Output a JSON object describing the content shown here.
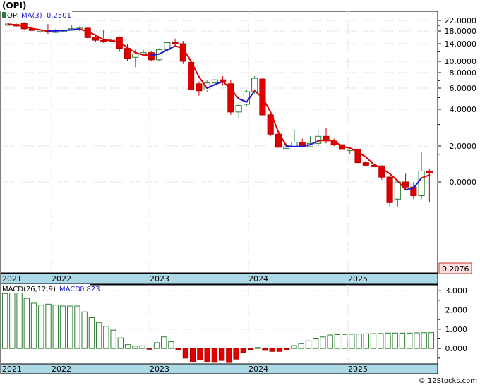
{
  "title": "(OPI)",
  "footer": "© 12Stocks.com",
  "chart_data": [
    {
      "type": "candlestick",
      "legend": {
        "symbol": "OPI",
        "ma_label": "MA(3)",
        "ma_value": "0.2501"
      },
      "last_price_label": "0.2076",
      "y_tick_labels": [
        "22.0000",
        "18.0000",
        "14.0000",
        "10.0000",
        "8.0000",
        "6.0000",
        "4.0000",
        "2.0000",
        "0.0000"
      ],
      "y_tick_values": [
        22,
        18,
        14,
        10,
        8,
        6,
        4,
        2,
        0.1
      ],
      "scale": "log",
      "x_tick_labels": [
        "2021",
        "2022",
        "2023",
        "2024",
        "2025"
      ],
      "x_tick_index": [
        0,
        10,
        20,
        30,
        40
      ],
      "bars": [
        {
          "o": 20.5,
          "h": 21.0,
          "l": 19.8,
          "c": 20.6,
          "up": true
        },
        {
          "o": 20.4,
          "h": 20.9,
          "l": 19.5,
          "c": 19.8,
          "up": false
        },
        {
          "o": 20.8,
          "h": 21.3,
          "l": 18.5,
          "c": 18.8,
          "up": false
        },
        {
          "o": 18.8,
          "h": 19.5,
          "l": 17.5,
          "c": 18.2,
          "up": false
        },
        {
          "o": 17.8,
          "h": 18.6,
          "l": 17.0,
          "c": 18.3,
          "up": true
        },
        {
          "o": 18.2,
          "h": 20.5,
          "l": 17.0,
          "c": 17.8,
          "up": false
        },
        {
          "o": 17.9,
          "h": 18.9,
          "l": 17.2,
          "c": 18.0,
          "up": true
        },
        {
          "o": 18.0,
          "h": 20.2,
          "l": 17.5,
          "c": 18.3,
          "up": true
        },
        {
          "o": 18.6,
          "h": 20.0,
          "l": 18.1,
          "c": 18.8,
          "up": true
        },
        {
          "o": 19.0,
          "h": 19.8,
          "l": 18.0,
          "c": 18.9,
          "up": true
        },
        {
          "o": 19.0,
          "h": 19.3,
          "l": 15.5,
          "c": 15.8,
          "up": false
        },
        {
          "o": 16.0,
          "h": 16.8,
          "l": 14.5,
          "c": 15.0,
          "up": false
        },
        {
          "o": 14.9,
          "h": 18.5,
          "l": 14.2,
          "c": 14.5,
          "up": false
        },
        {
          "o": 14.6,
          "h": 15.5,
          "l": 14.3,
          "c": 15.3,
          "up": true
        },
        {
          "o": 15.9,
          "h": 16.2,
          "l": 12.0,
          "c": 12.8,
          "up": false
        },
        {
          "o": 12.8,
          "h": 13.8,
          "l": 10.0,
          "c": 10.5,
          "up": false
        },
        {
          "o": 10.8,
          "h": 12.5,
          "l": 8.9,
          "c": 11.5,
          "up": true
        },
        {
          "o": 11.5,
          "h": 12.5,
          "l": 11.2,
          "c": 11.8,
          "up": true
        },
        {
          "o": 11.8,
          "h": 12.2,
          "l": 10.0,
          "c": 10.3,
          "up": false
        },
        {
          "o": 10.3,
          "h": 12.8,
          "l": 10.1,
          "c": 12.5,
          "up": true
        },
        {
          "o": 12.5,
          "h": 14.5,
          "l": 11.8,
          "c": 14.3,
          "up": true
        },
        {
          "o": 14.3,
          "h": 15.5,
          "l": 13.5,
          "c": 14.1,
          "up": false
        },
        {
          "o": 14.0,
          "h": 14.8,
          "l": 9.5,
          "c": 10.0,
          "up": false
        },
        {
          "o": 9.8,
          "h": 10.0,
          "l": 5.5,
          "c": 5.8,
          "up": false
        },
        {
          "o": 6.5,
          "h": 6.8,
          "l": 5.2,
          "c": 5.7,
          "up": false
        },
        {
          "o": 5.8,
          "h": 7.0,
          "l": 5.6,
          "c": 6.6,
          "up": true
        },
        {
          "o": 6.6,
          "h": 7.5,
          "l": 6.2,
          "c": 7.0,
          "up": true
        },
        {
          "o": 7.0,
          "h": 7.5,
          "l": 6.3,
          "c": 6.8,
          "up": false
        },
        {
          "o": 6.5,
          "h": 7.0,
          "l": 3.6,
          "c": 3.8,
          "up": false
        },
        {
          "o": 3.8,
          "h": 4.5,
          "l": 3.4,
          "c": 4.3,
          "up": true
        },
        {
          "o": 4.4,
          "h": 5.8,
          "l": 4.2,
          "c": 5.6,
          "up": true
        },
        {
          "o": 5.6,
          "h": 7.5,
          "l": 5.4,
          "c": 7.2,
          "up": true
        },
        {
          "o": 7.1,
          "h": 7.2,
          "l": 3.5,
          "c": 3.6,
          "up": false
        },
        {
          "o": 3.6,
          "h": 3.7,
          "l": 2.4,
          "c": 2.5,
          "up": false
        },
        {
          "o": 2.5,
          "h": 2.6,
          "l": 1.75,
          "c": 1.8,
          "up": false
        },
        {
          "o": 1.8,
          "h": 2.1,
          "l": 1.7,
          "c": 1.85,
          "up": true
        },
        {
          "o": 1.9,
          "h": 2.7,
          "l": 1.85,
          "c": 2.15,
          "up": true
        },
        {
          "o": 2.15,
          "h": 2.3,
          "l": 1.8,
          "c": 1.9,
          "up": false
        },
        {
          "o": 1.9,
          "h": 2.4,
          "l": 1.8,
          "c": 2.1,
          "up": true
        },
        {
          "o": 2.1,
          "h": 2.7,
          "l": 2.0,
          "c": 2.4,
          "up": true
        },
        {
          "o": 2.4,
          "h": 2.8,
          "l": 2.1,
          "c": 2.2,
          "up": false
        },
        {
          "o": 2.2,
          "h": 2.3,
          "l": 2.0,
          "c": 2.05,
          "up": false
        },
        {
          "o": 2.05,
          "h": 2.1,
          "l": 1.4,
          "c": 1.5,
          "up": false
        },
        {
          "o": 1.45,
          "h": 1.65,
          "l": 1.0,
          "c": 1.55,
          "up": true
        },
        {
          "o": 1.5,
          "h": 1.55,
          "l": 0.48,
          "c": 0.5,
          "up": false
        },
        {
          "o": 0.5,
          "h": 0.55,
          "l": 0.34,
          "c": 0.4,
          "up": false
        },
        {
          "o": 0.4,
          "h": 0.41,
          "l": 0.38,
          "c": 0.39,
          "up": false
        },
        {
          "o": 0.38,
          "h": 0.4,
          "l": 0.12,
          "c": 0.15,
          "up": false
        },
        {
          "o": 0.15,
          "h": 0.16,
          "l": 0.06,
          "c": 0.065,
          "up": false
        },
        {
          "o": 0.07,
          "h": 0.12,
          "l": 0.06,
          "c": 0.1,
          "up": true
        },
        {
          "o": 0.1,
          "h": 0.2,
          "l": 0.085,
          "c": 0.09,
          "up": false
        },
        {
          "o": 0.09,
          "h": 0.1,
          "l": 0.07,
          "c": 0.075,
          "up": false
        },
        {
          "o": 0.075,
          "h": 1.2,
          "l": 0.07,
          "c": 0.25,
          "up": true
        },
        {
          "o": 0.25,
          "h": 0.3,
          "l": 0.065,
          "c": 0.2076,
          "up": false
        }
      ],
      "ma3": [
        20.5,
        20.2,
        19.7,
        18.9,
        18.4,
        18.1,
        18.0,
        18.2,
        18.4,
        18.7,
        17.8,
        16.6,
        15.1,
        14.9,
        14.4,
        13.0,
        11.8,
        11.3,
        11.2,
        11.5,
        12.4,
        13.4,
        12.8,
        10.0,
        7.4,
        6.0,
        6.4,
        6.8,
        5.9,
        4.9,
        4.6,
        5.7,
        5.0,
        3.8,
        2.6,
        2.0,
        1.9,
        1.95,
        2.05,
        2.2,
        2.25,
        2.2,
        1.9,
        1.7,
        1.2,
        0.8,
        0.43,
        0.31,
        0.2,
        0.11,
        0.085,
        0.088,
        0.14,
        0.178
      ],
      "ma_up_flags": [
        false,
        false,
        false,
        false,
        false,
        false,
        true,
        true,
        true,
        true,
        false,
        false,
        false,
        false,
        false,
        false,
        false,
        false,
        false,
        true,
        true,
        true,
        false,
        false,
        false,
        false,
        true,
        true,
        false,
        false,
        true,
        true,
        false,
        false,
        false,
        false,
        true,
        true,
        true,
        true,
        false,
        false,
        false,
        false,
        false,
        false,
        false,
        false,
        false,
        false,
        false,
        true,
        true,
        false
      ]
    },
    {
      "type": "bar",
      "legend": {
        "params": "MACD(26,12,9)",
        "label": "MACD:",
        "value": "0.823"
      },
      "y_tick_labels": [
        "3.000",
        "2.000",
        "1.000",
        "0.000"
      ],
      "y_tick_values": [
        3,
        2,
        1,
        0
      ],
      "ylim": [
        -0.8,
        3.3
      ],
      "values": [
        2.85,
        3.0,
        2.9,
        2.6,
        2.35,
        2.25,
        2.3,
        2.25,
        2.2,
        2.2,
        2.2,
        1.9,
        1.6,
        1.35,
        1.15,
        0.95,
        0.55,
        0.2,
        0.12,
        0.14,
        -0.04,
        0.3,
        0.6,
        0.35,
        -0.05,
        -0.5,
        -0.7,
        -0.6,
        -0.7,
        -0.72,
        -0.62,
        -0.73,
        -0.55,
        -0.2,
        -0.05,
        0.05,
        -0.1,
        -0.15,
        -0.15,
        -0.05,
        0.15,
        0.25,
        0.4,
        0.5,
        0.6,
        0.7,
        0.72,
        0.73,
        0.74,
        0.75,
        0.76,
        0.77,
        0.78,
        0.8,
        0.8,
        0.8,
        0.8,
        0.81,
        0.82,
        0.823
      ]
    }
  ]
}
